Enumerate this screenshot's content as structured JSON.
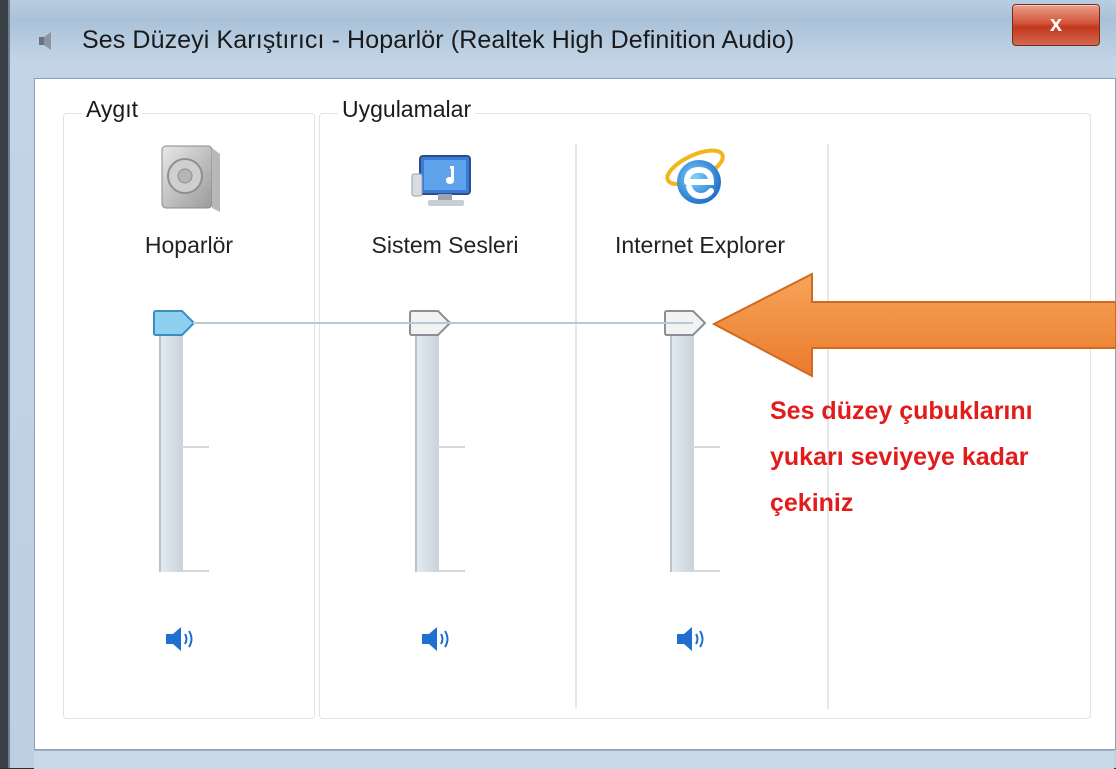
{
  "window": {
    "title": "Ses Düzeyi Karıştırıcı - Hoparlör (Realtek High Definition Audio)",
    "close_label": "x"
  },
  "groups": {
    "device_label": "Aygıt",
    "apps_label": "Uygulamalar"
  },
  "channels": [
    {
      "label": "Hoparlör",
      "icon": "speaker-device-icon",
      "volume": 1.0,
      "active": true
    },
    {
      "label": "Sistem Sesleri",
      "icon": "system-sounds-icon",
      "volume": 1.0,
      "active": false
    },
    {
      "label": "Internet Explorer",
      "icon": "internet-explorer-icon",
      "volume": 1.0,
      "active": false
    }
  ],
  "annotation": {
    "lines": [
      "Ses düzey çubuklarını",
      "yukarı seviyeye kadar",
      "çekiniz"
    ],
    "color": "#e21b1b",
    "arrow_color": "#f08a3a"
  }
}
